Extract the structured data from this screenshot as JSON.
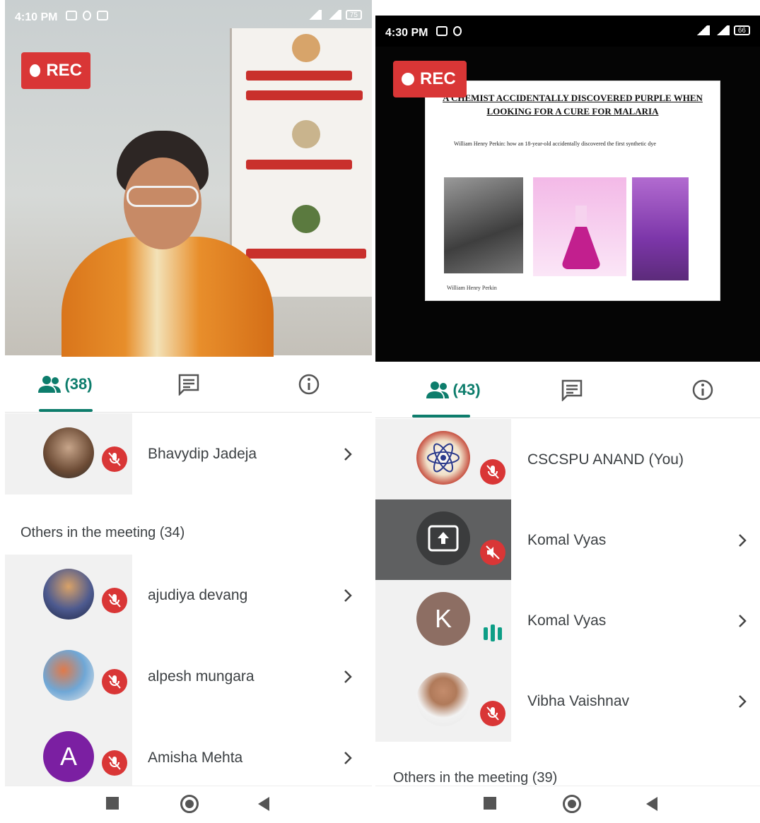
{
  "screens": [
    {
      "status": {
        "time": "4:10 PM",
        "battery": "75"
      },
      "rec_label": "REC",
      "tabs": {
        "people_count": "(38)"
      },
      "pinned": {
        "name": "Bhavydip Jadeja"
      },
      "section": "Others in the meeting (34)",
      "participants": [
        {
          "name": "ajudiya devang"
        },
        {
          "name": "alpesh mungara"
        },
        {
          "name": "Amisha Mehta",
          "initial": "A"
        }
      ]
    },
    {
      "status": {
        "time": "4:30 PM",
        "battery": "66"
      },
      "rec_label": "REC",
      "slide": {
        "title": "A CHEMIST ACCIDENTALLY DISCOVERED PURPLE WHEN LOOKING FOR A CURE FOR MALARIA",
        "body": "William Henry Perkin: how an 18-year-old accidentally discovered the first synthetic dye",
        "caption": "William Henry Perkin"
      },
      "tabs": {
        "people_count": "(43)"
      },
      "participants": [
        {
          "name": "CSCSPU ANAND (You)"
        },
        {
          "name": "Komal Vyas"
        },
        {
          "name": "Komal Vyas",
          "initial": "K"
        },
        {
          "name": "Vibha Vaishnav"
        }
      ],
      "section": "Others in the meeting (39)"
    }
  ],
  "colors": {
    "accent": "#0d7d6c",
    "rec": "#d93636",
    "mic_off": "#d93636",
    "avatar_a": "#7b1fa2",
    "avatar_k": "#8d6e63"
  }
}
